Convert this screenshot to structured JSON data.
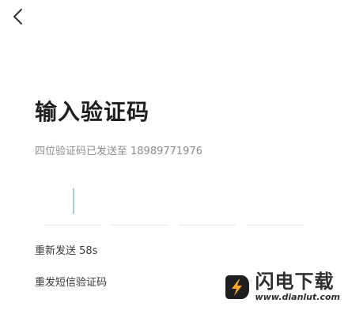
{
  "header": {
    "back_icon": "chevron-left-icon"
  },
  "main": {
    "title": "输入验证码",
    "subtitle_prefix": "四位验证码已发送至",
    "phone": "18989771976",
    "code_boxes": [
      "",
      "",
      "",
      ""
    ],
    "resend_timer": "重新发送 58s",
    "resend_sms": "重发短信验证码"
  },
  "watermark": {
    "name": "闪电下载",
    "url": "www.dianlut.com",
    "logo_icon": "lightning-logo-icon",
    "colors": {
      "logo_dark": "#1f1f1f",
      "logo_accent": "#f5a623"
    }
  },
  "colors": {
    "title": "#1f1f1f",
    "subtitle": "#8c8c8c",
    "caret": "#9fd0d8",
    "underline": "#e4e4e4"
  }
}
